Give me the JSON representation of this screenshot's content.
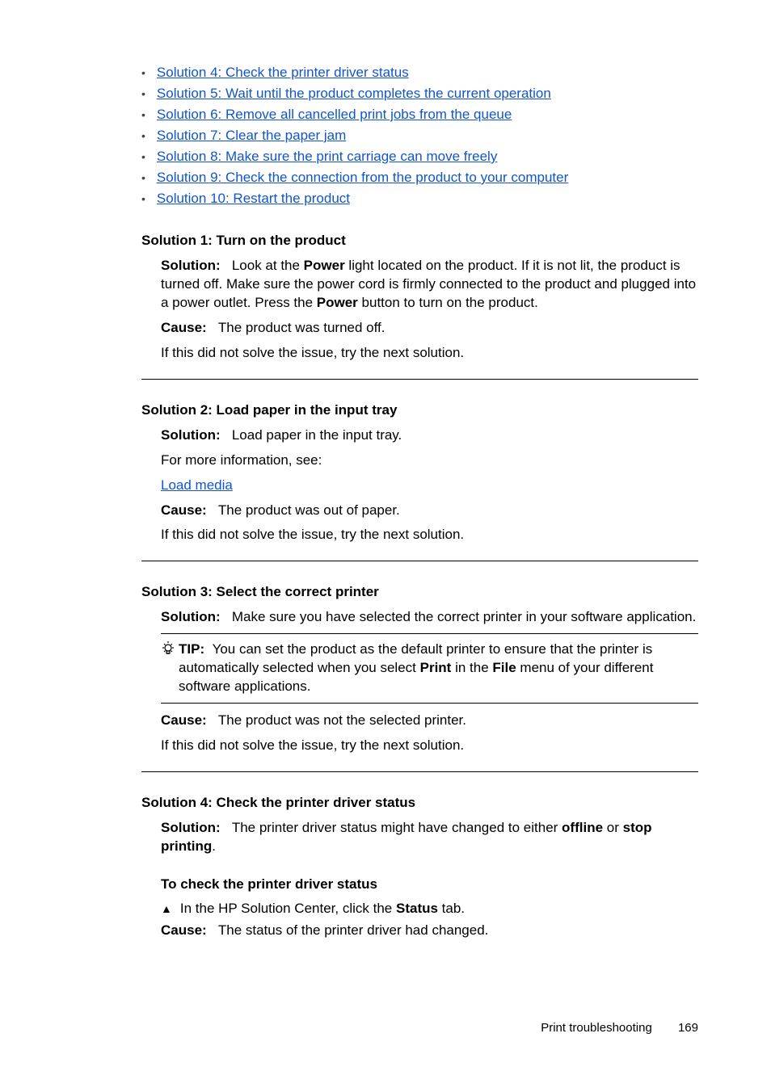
{
  "links": [
    "Solution 4: Check the printer driver status",
    "Solution 5: Wait until the product completes the current operation",
    "Solution 6: Remove all cancelled print jobs from the queue",
    "Solution 7: Clear the paper jam",
    "Solution 8: Make sure the print carriage can move freely",
    "Solution 9: Check the connection from the product to your computer",
    "Solution 10: Restart the product"
  ],
  "sol1": {
    "title": "Solution 1: Turn on the product",
    "sol_label": "Solution:",
    "sol_pre": "Look at the ",
    "sol_bold1": "Power",
    "sol_mid": " light located on the product. If it is not lit, the product is turned off. Make sure the power cord is firmly connected to the product and plugged into a power outlet. Press the ",
    "sol_bold2": "Power",
    "sol_end": " button to turn on the product.",
    "cause_label": "Cause:",
    "cause_text": "The product was turned off.",
    "next": "If this did not solve the issue, try the next solution."
  },
  "sol2": {
    "title": "Solution 2: Load paper in the input tray",
    "sol_label": "Solution:",
    "sol_text": "Load paper in the input tray.",
    "more": "For more information, see:",
    "link": "Load media",
    "cause_label": "Cause:",
    "cause_text": "The product was out of paper.",
    "next": "If this did not solve the issue, try the next solution."
  },
  "sol3": {
    "title": "Solution 3: Select the correct printer",
    "sol_label": "Solution:",
    "sol_text": "Make sure you have selected the correct printer in your software application.",
    "tip_label": "TIP:",
    "tip_pre": "You can set the product as the default printer to ensure that the printer is automatically selected when you select ",
    "tip_bold1": "Print",
    "tip_mid": " in the ",
    "tip_bold2": "File",
    "tip_end": " menu of your different software applications.",
    "cause_label": "Cause:",
    "cause_text": "The product was not the selected printer.",
    "next": "If this did not solve the issue, try the next solution."
  },
  "sol4": {
    "title": "Solution 4: Check the printer driver status",
    "sol_label": "Solution:",
    "sol_pre": "The printer driver status might have changed to either ",
    "sol_bold1": "offline",
    "sol_mid": " or ",
    "sol_bold2": "stop printing",
    "sol_end": ".",
    "sub_title": "To check the printer driver status",
    "step_pre": "In the HP Solution Center, click the ",
    "step_bold": "Status",
    "step_end": " tab.",
    "cause_label": "Cause:",
    "cause_text": "The status of the printer driver had changed."
  },
  "footer": {
    "section": "Print troubleshooting",
    "page": "169"
  }
}
